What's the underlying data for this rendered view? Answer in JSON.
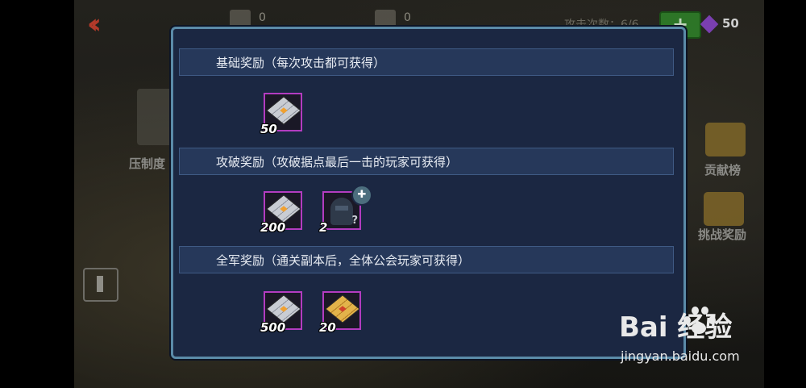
{
  "hud": {
    "back_icon": "double-chevron-left-icon",
    "resource1_value": "0",
    "resource2_value": "0",
    "attack_count": "攻击次数：6/6",
    "add_label": "+",
    "gem_count": "50"
  },
  "side": {
    "left_label": "压制度",
    "right_label1": "贡献榜",
    "right_label2": "挑战奖励"
  },
  "modal": {
    "sections": [
      {
        "title": "基础奖励（每次攻击都可获得）",
        "rewards": [
          {
            "icon": "silver-cube-icon",
            "count": "50"
          }
        ]
      },
      {
        "title": "攻破奖励（攻破据点最后一击的玩家可获得）",
        "rewards": [
          {
            "icon": "silver-cube-icon",
            "count": "200"
          },
          {
            "icon": "mystery-character-icon",
            "count": "2",
            "badge": "puzzle-piece-icon"
          }
        ]
      },
      {
        "title": "全军奖励（通关副本后，全体公会玩家可获得）",
        "rewards": [
          {
            "icon": "silver-cube-icon",
            "count": "500"
          },
          {
            "icon": "gold-cube-icon",
            "count": "20"
          }
        ]
      }
    ]
  },
  "watermark": {
    "brand": "Bai   经验",
    "url": "jingyan.baidu.com"
  },
  "colors": {
    "modal_bg": "#1b2742",
    "modal_border": "#5b8ba8",
    "header_bg": "#26385a",
    "reward_border": "#b33cc0"
  }
}
